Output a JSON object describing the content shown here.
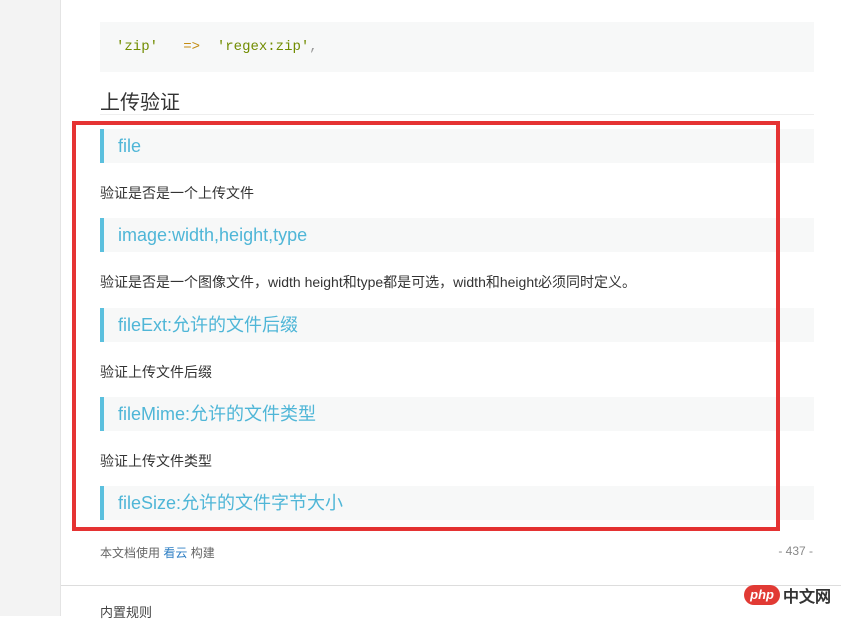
{
  "code": {
    "key": "'zip'",
    "arrow": "=>",
    "value": "'regex:zip'",
    "trail": ","
  },
  "section": {
    "title": "上传验证"
  },
  "rules": [
    {
      "name": "file",
      "desc": "验证是否是一个上传文件"
    },
    {
      "name": "image:width,height,type",
      "desc": "验证是否是一个图像文件，width height和type都是可选，width和height必须同时定义。"
    },
    {
      "name": "fileExt:允许的文件后缀",
      "desc": "验证上传文件后缀"
    },
    {
      "name": "fileMime:允许的文件类型",
      "desc": "验证上传文件类型"
    },
    {
      "name": "fileSize:允许的文件字节大小"
    }
  ],
  "footer": {
    "prefix": "本文档使用",
    "link": "看云",
    "suffix": "构建",
    "page_number": "- 437 -"
  },
  "next_page": {
    "title": "内置规则"
  },
  "watermark": {
    "logo": "php",
    "text": "中文网"
  },
  "colors": {
    "accent": "#5bc0de",
    "highlight_border": "#e53333",
    "link": "#2f7fc4"
  }
}
